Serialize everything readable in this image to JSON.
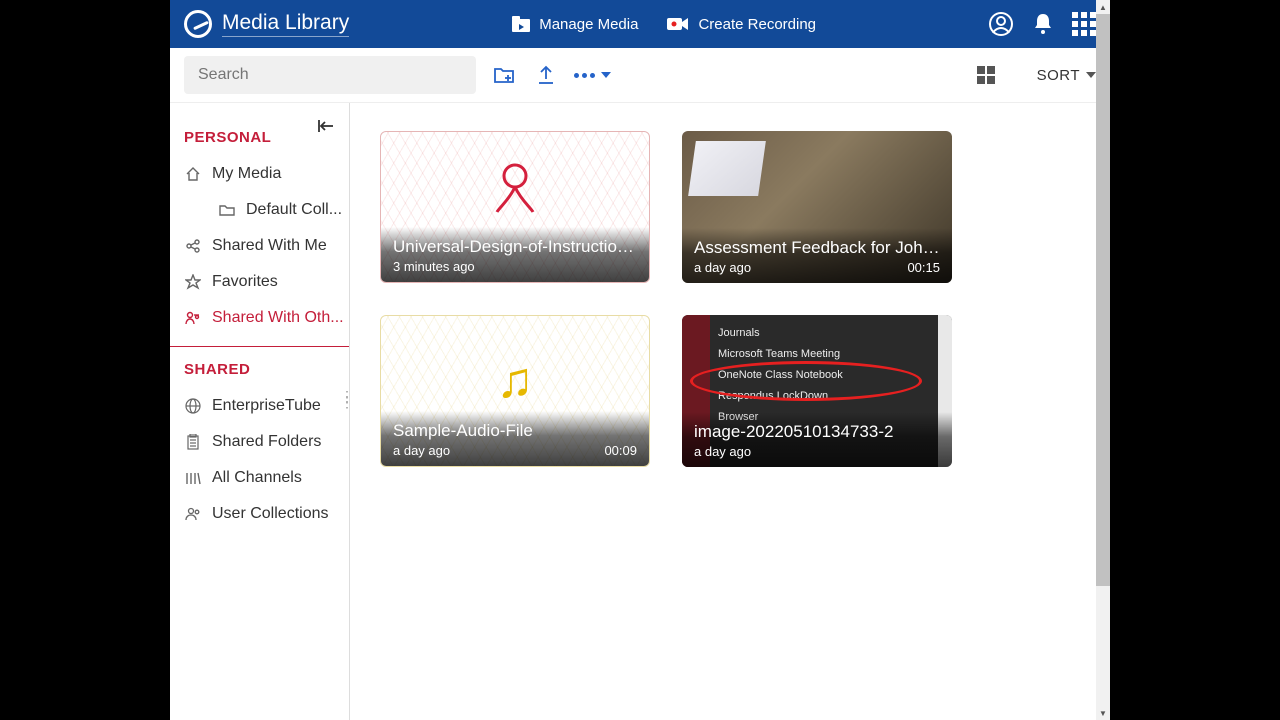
{
  "header": {
    "brand": "Media Library",
    "manage": "Manage Media",
    "create": "Create Recording"
  },
  "toolbar": {
    "search_placeholder": "Search",
    "sort_label": "SORT"
  },
  "sidebar": {
    "section_personal": "PERSONAL",
    "section_shared": "SHARED",
    "personal": [
      {
        "label": "My Media"
      },
      {
        "label": "Default Coll..."
      },
      {
        "label": "Shared With Me"
      },
      {
        "label": "Favorites"
      },
      {
        "label": "Shared With Oth..."
      }
    ],
    "shared": [
      {
        "label": "EnterpriseTube"
      },
      {
        "label": "Shared Folders"
      },
      {
        "label": "All Channels"
      },
      {
        "label": "User Collections"
      }
    ]
  },
  "cards": [
    {
      "title": "Universal-Design-of-Instruction-...",
      "time": "3 minutes ago",
      "duration": ""
    },
    {
      "title": "Assessment Feedback for John ...",
      "time": "a day ago",
      "duration": "00:15"
    },
    {
      "title": "Sample-Audio-File",
      "time": "a day ago",
      "duration": "00:09"
    },
    {
      "title": "image-20220510134733-2",
      "time": "a day ago",
      "duration": ""
    }
  ],
  "screenshot_lines": [
    "Journals",
    "Microsoft Teams Meeting",
    "OneNote Class Notebook",
    "Respondus LockDown",
    "Browser"
  ]
}
